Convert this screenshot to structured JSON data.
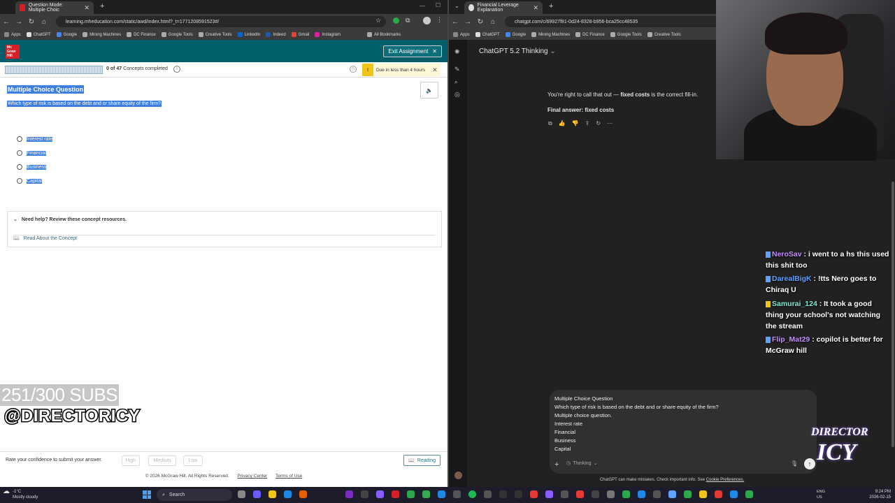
{
  "left_browser": {
    "tab_title": "Question Mode: Multiple Choic",
    "url": "learning.mheducation.com/static/awd/index.html?_t=1771208591523#/",
    "bookmarks": [
      "Apps",
      "ChatGPT",
      "Google",
      "Mining Machines",
      "DC Finance",
      "Google Tools",
      "Creative Tools",
      "LinkedIn",
      "Indeed",
      "Gmail",
      "Instagram"
    ],
    "all_bookmarks": "All Bookmarks",
    "logo_text": "Mc Graw Hill",
    "exit_label": "Exit Assignment",
    "progress_count": "0 of 47",
    "progress_label": "Concepts completed",
    "due_label": "Due in less than 4 hours",
    "question_title": "Multiple Choice Question",
    "question_text": "Which type of risk is based on the debt and or share equity of the firm?",
    "options": [
      "Interest rate",
      "Financial",
      "Business",
      "Capital"
    ],
    "help_title": "Need help? Review these concept resources.",
    "help_link": "Read About the Concept",
    "confidence_prompt": "Rate your confidence to submit your answer.",
    "confidence_levels": [
      "High",
      "Medium",
      "Low"
    ],
    "reading_label": "Reading",
    "copyright": "© 2026 McGraw Hill. All Rights Reserved.",
    "privacy": "Privacy Center",
    "terms": "Terms of Use"
  },
  "overlay": {
    "subs": "251/300 SUBS",
    "handle": "@DIRECTORICY",
    "logo_top": "DIRECTOR",
    "logo_bottom": "ICY"
  },
  "right_browser": {
    "tab_title": "Financial Leverage Explanation",
    "url": "chatgpt.com/c/69927f81-0d24-8328-b956-bca25cc48535",
    "bookmarks": [
      "Apps",
      "ChatGPT",
      "Google",
      "Mining Machines",
      "DC Finance",
      "Google Tools",
      "Creative Tools"
    ],
    "model": "ChatGPT 5.2 Thinking",
    "reply_prefix": "You're right to call that out — ",
    "reply_bold": "fixed costs",
    "reply_suffix": " is the correct fill-in.",
    "final_answer": "Final answer: fixed costs",
    "composer_lines": [
      "Multiple Choice Question",
      "Which type of risk is based on the debt and or share equity of the firm?",
      "Multiple choice question.",
      "Interest rate",
      "Financial",
      "Business",
      "Capital"
    ],
    "thinking_label": "Thinking",
    "disclaimer": "ChatGPT can make mistakes. Check important info. See",
    "cookie_link": "Cookie Preferences."
  },
  "chat_messages": [
    {
      "user": "NeroSav",
      "text": ": i went to a hs this used this shit too"
    },
    {
      "user": "DarealBigK",
      "text": ": !tts Nero goes to Chiraq U"
    },
    {
      "user": "Samurai_124",
      "text": ": It took a good thing your school's not watching the stream"
    },
    {
      "user": "Flip_Mat29",
      "text": ": copilot is better for McGraw hill"
    }
  ],
  "taskbar": {
    "weather_temp": "-1°C",
    "weather_desc": "Mostly cloudy",
    "search_label": "Search",
    "lang": "ENG",
    "region": "US",
    "time": "9:24 PM",
    "date": "2026-02-15"
  }
}
